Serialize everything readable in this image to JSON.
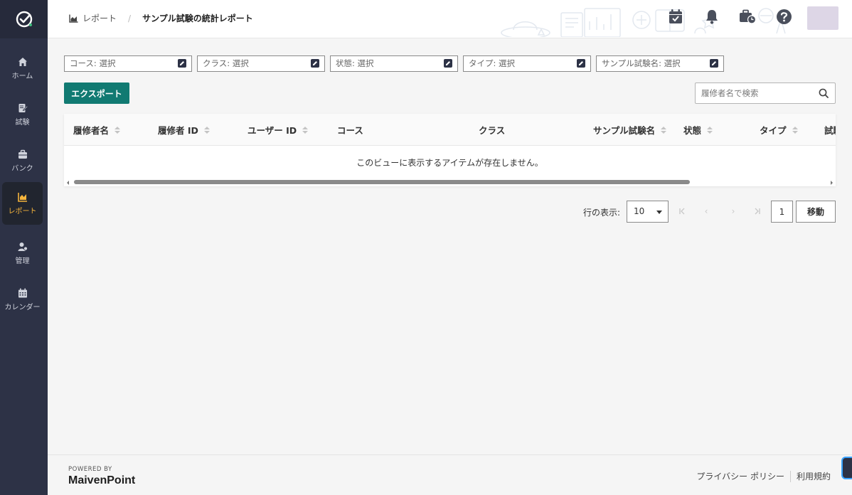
{
  "sidebar": {
    "items": [
      {
        "label": "ホーム",
        "icon": "home-icon"
      },
      {
        "label": "試験",
        "icon": "exam-icon"
      },
      {
        "label": "バンク",
        "icon": "bank-icon"
      },
      {
        "label": "レポート",
        "icon": "report-icon",
        "active": true
      },
      {
        "label": "管理",
        "icon": "admin-icon"
      },
      {
        "label": "カレンダー",
        "icon": "calendar-icon"
      }
    ]
  },
  "header": {
    "breadcrumb_root": "レポート",
    "breadcrumb_separator": "/",
    "breadcrumb_current": "サンプル試験の統計レポート"
  },
  "filters": [
    {
      "label": "コース: 選択"
    },
    {
      "label": "クラス: 選択"
    },
    {
      "label": "状態: 選択"
    },
    {
      "label": "タイプ: 選択"
    },
    {
      "label": "サンプル試験名: 選択"
    }
  ],
  "toolbar": {
    "export_label": "エクスポート",
    "search_placeholder": "履修者名で検索"
  },
  "table": {
    "columns": [
      "履修者名",
      "履修者 ID",
      "ユーザー ID",
      "コース",
      "クラス",
      "サンプル試験名",
      "状態",
      "タイプ",
      "試験"
    ],
    "empty_message": "このビューに表示するアイテムが存在しません。"
  },
  "pagination": {
    "rows_label": "行の表示:",
    "rows_per_page": "10",
    "current_page": "1",
    "go_label": "移動",
    "first": "K",
    "prev": "‹",
    "next": "›",
    "last": "K"
  },
  "footer": {
    "powered_by": "POWERED BY",
    "brand": "MaivenPoint",
    "privacy": "プライバシー ポリシー",
    "terms": "利用規約"
  },
  "colors": {
    "sidebar_bg": "#2d3246",
    "active_accent": "#f5b43c",
    "primary_button": "#117a72"
  }
}
